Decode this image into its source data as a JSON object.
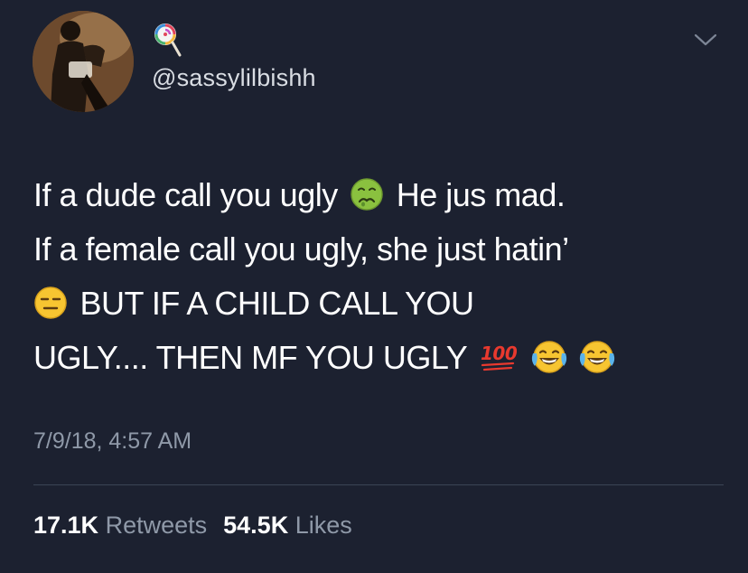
{
  "tweet": {
    "handle": "@sassylilbishh",
    "lines": [
      {
        "before": "If a dude call you ugly",
        "emoji": "nauseated-face",
        "after": "He jus mad."
      },
      {
        "text": "If a female call you ugly, she just hatin’"
      },
      {
        "emoji": "expressionless-face",
        "after": "BUT IF A CHILD CALL YOU"
      },
      {
        "text": "UGLY.... THEN MF YOU UGLY",
        "emojis": [
          "hundred-points",
          "face-with-tears-of-joy",
          "face-with-tears-of-joy"
        ]
      }
    ],
    "timestamp": "7/9/18, 4:57 AM",
    "stats": {
      "retweets_count": "17.1K",
      "retweets_label": "Retweets",
      "likes_count": "54.5K",
      "likes_label": "Likes"
    }
  },
  "icons": {
    "name_emoji": "lollipop-icon",
    "menu": "chevron-down-icon"
  },
  "colors": {
    "background": "#1c2130",
    "text": "#ffffff",
    "secondary_text": "#8f99a8",
    "divider": "#3b4455"
  }
}
